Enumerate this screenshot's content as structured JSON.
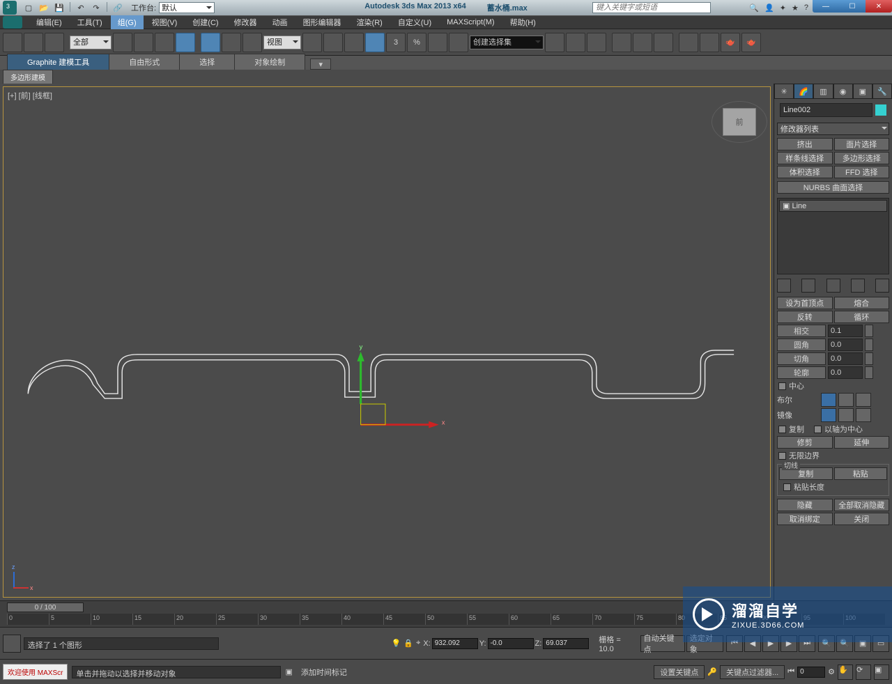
{
  "app": {
    "title": "Autodesk 3ds Max  2013 x64",
    "filename": "蓄水桶.max",
    "workspace_label": "工作台:",
    "workspace_value": "默认",
    "search_placeholder": "键入关键字或短语"
  },
  "menu": [
    "编辑(E)",
    "工具(T)",
    "组(G)",
    "视图(V)",
    "创建(C)",
    "修改器",
    "动画",
    "图形编辑器",
    "渲染(R)",
    "自定义(U)",
    "MAXScript(M)",
    "帮助(H)"
  ],
  "menu_active_index": 2,
  "toolbar": {
    "filter_dd": "全部",
    "view_dd": "视图",
    "selset_dd": "创建选择集"
  },
  "ribbon": {
    "tabs": [
      "Graphite 建模工具",
      "自由形式",
      "选择",
      "对象绘制"
    ],
    "active": 0,
    "body_button": "多边形建模"
  },
  "viewport": {
    "label": "[+] [前] [线框]",
    "cube_face": "前",
    "axis_y": "y",
    "axis_x": "x",
    "axis_z": "z"
  },
  "cmdpanel": {
    "object_name": "Line002",
    "modlist_dd": "修改器列表",
    "preset_buttons": [
      "挤出",
      "面片选择",
      "样条线选择",
      "多边形选择",
      "体积选择",
      "FFD 选择"
    ],
    "nurbs_label": "NURBS 曲面选择",
    "stack_item": "Line",
    "geom": {
      "btn_first_vertex": "设为首顶点",
      "btn_fuse": "熔合",
      "btn_reverse": "反转",
      "btn_cycle": "循环",
      "label_cross": "相交",
      "val_cross": "0.1",
      "label_fillet": "圆角",
      "val_fillet": "0.0",
      "label_chamfer": "切角",
      "val_chamfer": "0.0",
      "label_outline": "轮廓",
      "val_outline": "0.0",
      "chk_center": "中心",
      "btn_bool": "布尔",
      "btn_mirror": "镜像",
      "chk_copy": "复制",
      "chk_aboutpivot": "以轴为中心",
      "btn_trim": "修剪",
      "btn_extend": "延伸",
      "chk_infinite": "无限边界",
      "group_tangent": "切线",
      "btn_copy2": "复制",
      "btn_paste": "粘贴",
      "chk_pastelen": "粘贴长度",
      "btn_hide": "隐藏",
      "btn_unhideall": "全部取消隐藏",
      "btn_unbind": "取消绑定",
      "btn_close": "关闭"
    }
  },
  "timeline": {
    "slider": "0 / 100",
    "ticks": [
      "0",
      "5",
      "10",
      "15",
      "20",
      "25",
      "30",
      "35",
      "40",
      "45",
      "50",
      "55",
      "60",
      "65",
      "70",
      "75",
      "80",
      "85",
      "90",
      "95",
      "100"
    ]
  },
  "status": {
    "selected_text": "选择了 1 个图形",
    "prompt_text": "单击并拖动以选择并移动对象",
    "x_label": "X:",
    "x_val": "932.092",
    "y_label": "Y:",
    "y_val": "-0.0",
    "z_label": "Z:",
    "z_val": "69.037",
    "grid_label": "栅格 = 10.0",
    "addtime_label": "添加时间标记",
    "autokey": "自动关键点",
    "setkey": "设置关键点",
    "selset": "选定对象",
    "keyfilter": "关键点过滤器...",
    "frame": "0",
    "welcome": "欢迎使用  MAXScr"
  },
  "watermark": {
    "line1": "溜溜自学",
    "line2": "ZIXUE.3D66.COM"
  }
}
